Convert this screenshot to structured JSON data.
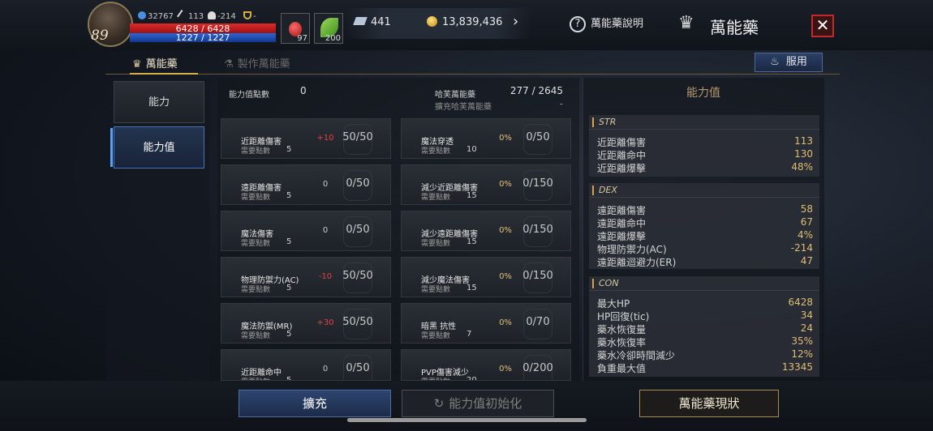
{
  "player": {
    "level": "89",
    "stat_a": "32767",
    "stat_b": "113",
    "stat_c": "-214",
    "stat_d": "-",
    "hp": "6428 / 6428",
    "mp": "1227 / 1227",
    "pot1_count": "97",
    "pot2_count": "200"
  },
  "currency": {
    "crystal": "441",
    "gold": "13,839,436"
  },
  "header": {
    "help_label": "萬能藥說明",
    "title": "萬能藥"
  },
  "tabs": [
    {
      "label": "萬能藥",
      "active": true
    },
    {
      "label": "製作萬能藥",
      "active": false
    }
  ],
  "use_button": "服用",
  "side_menu": [
    {
      "label": "能力"
    },
    {
      "label": "能力值",
      "active": true
    }
  ],
  "summary": {
    "points_label": "能力值點數",
    "points_value": "0",
    "elixir_label": "哈芙萬能藥",
    "elixir_value": "277 / 2645",
    "expand_label": "擴充哈芙萬能藥",
    "expand_value": "-"
  },
  "req_label": "需要點數",
  "cards_left": [
    {
      "name": "近距離傷害",
      "req": "5",
      "bonus": "+10",
      "progress": "50/50"
    },
    {
      "name": "遠距離傷害",
      "req": "5",
      "bonus": "0",
      "progress": "0/50"
    },
    {
      "name": "魔法傷害",
      "req": "5",
      "bonus": "0",
      "progress": "0/50"
    },
    {
      "name": "物理防禦力(AC)",
      "req": "5",
      "bonus": "-10",
      "progress": "50/50"
    },
    {
      "name": "魔法防禦(MR)",
      "req": "5",
      "bonus": "+30",
      "progress": "50/50"
    },
    {
      "name": "近距離命中",
      "req": "5",
      "bonus": "0",
      "progress": "0/50"
    }
  ],
  "cards_right": [
    {
      "name": "魔法穿透",
      "req": "10",
      "bonus": "0%",
      "progress": "0/50"
    },
    {
      "name": "減少近距離傷害",
      "req": "15",
      "bonus": "0%",
      "progress": "0/150"
    },
    {
      "name": "減少遠距離傷害",
      "req": "15",
      "bonus": "0%",
      "progress": "0/150"
    },
    {
      "name": "減少魔法傷害",
      "req": "15",
      "bonus": "0%",
      "progress": "0/150"
    },
    {
      "name": "暗黑 抗性",
      "req": "7",
      "bonus": "0%",
      "progress": "0/70"
    },
    {
      "name": "PVP傷害減少",
      "req": "20",
      "bonus": "0%",
      "progress": "0/200"
    }
  ],
  "stats_panel": {
    "title": "能力值",
    "groups": [
      {
        "name": "STR",
        "rows": [
          {
            "label": "近距離傷害",
            "value": "113"
          },
          {
            "label": "近距離命中",
            "value": "130"
          },
          {
            "label": "近距離爆擊",
            "value": "48%"
          }
        ]
      },
      {
        "name": "DEX",
        "rows": [
          {
            "label": "遠距離傷害",
            "value": "58"
          },
          {
            "label": "遠距離命中",
            "value": "67"
          },
          {
            "label": "遠距離爆擊",
            "value": "4%"
          },
          {
            "label": "物理防禦力(AC)",
            "value": "-214"
          },
          {
            "label": "遠距離迴避力(ER)",
            "value": "47"
          }
        ]
      },
      {
        "name": "CON",
        "rows": [
          {
            "label": "最大HP",
            "value": "6428"
          },
          {
            "label": "HP回復(tic)",
            "value": "34"
          },
          {
            "label": "藥水恢復量",
            "value": "24"
          },
          {
            "label": "藥水恢復率",
            "value": "35%"
          },
          {
            "label": "藥水冷卻時間減少",
            "value": "12%"
          },
          {
            "label": "負重最大值",
            "value": "13345"
          }
        ]
      }
    ]
  },
  "bottom": {
    "expand": "擴充",
    "reset": "能力值初始化",
    "status": "萬能藥現狀"
  },
  "colors": {
    "accent_blue": "#4b74b8",
    "hp_red": "#e02a2a",
    "mp_blue": "#2a66d8",
    "value_gold": "#e0bd74"
  }
}
